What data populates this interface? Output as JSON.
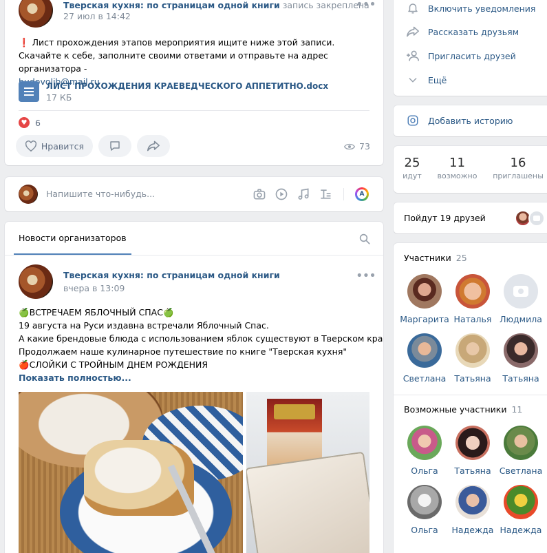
{
  "pinned_post": {
    "author": "Тверская кухня: по страницам одной книги",
    "pinned_label": "запись закреплена",
    "date": "27 июл в 14:42",
    "line1": "Лист прохождения этапов мероприятия ищите ниже этой записи.",
    "line2": "Скачайте к себе, заполните своими ответами и отправьте на адрес организатора -",
    "email": "budovolib@mail.ru",
    "doc_name": "ЛИСТ ПРОХОЖДЕНИЯ КРАЕВЕДЧЕСКОГО АППЕТИТНО.docx",
    "doc_size": "17 КБ",
    "reactions_count": "6",
    "like_label": "Нравится",
    "views": "73",
    "exclamation": "❗"
  },
  "composer": {
    "placeholder": "Напишите что-нибудь..."
  },
  "news": {
    "tab_label": "Новости организаторов",
    "post": {
      "author": "Тверская кухня: по страницам одной книги",
      "date": "вчера в 13:09",
      "line1": "🍏ВСТРЕЧАЕМ ЯБЛОЧНЫЙ СПАС🍏",
      "line2": "19 августа на Руси издавна встречали Яблочный Спас.",
      "line3": "А какие брендовые блюда с использованием яблок существуют в Тверском крае?",
      "line4": "Продолжаем наше кулинарное путешествие по книге \"Тверская кухня\"",
      "line5": "🍎СЛОЙКИ С ТРОЙНЫМ ДНЕМ РОЖДЕНИЯ",
      "show_more": "Показать полностью..."
    }
  },
  "sidebar": {
    "menu": [
      {
        "label": "Включить уведомления",
        "icon": "bell-icon"
      },
      {
        "label": "Рассказать друзьям",
        "icon": "share-icon"
      },
      {
        "label": "Пригласить друзей",
        "icon": "add-user-icon"
      },
      {
        "label": "Ещё",
        "icon": "chevron-down-icon"
      }
    ],
    "add_story": "Добавить историю",
    "stats": [
      {
        "value": "25",
        "label": "идут"
      },
      {
        "value": "11",
        "label": "возможно"
      },
      {
        "value": "16",
        "label": "приглашены"
      }
    ],
    "friends_going": "Пойдут 19 друзей",
    "participants": {
      "title": "Участники",
      "count": "25",
      "people": [
        "Маргарита",
        "Наталья",
        "Людмила",
        "Светлана",
        "Татьяна",
        "Татьяна"
      ]
    },
    "maybe": {
      "title": "Возможные участники",
      "count": "11",
      "people": [
        "Ольга",
        "Татьяна",
        "Светлана",
        "Ольга",
        "Надежда",
        "Надежда"
      ]
    }
  },
  "colors": {
    "link": "#2a5885",
    "accent": "#4a76a8",
    "heart": "#e64646",
    "bg": "#edeef0"
  }
}
